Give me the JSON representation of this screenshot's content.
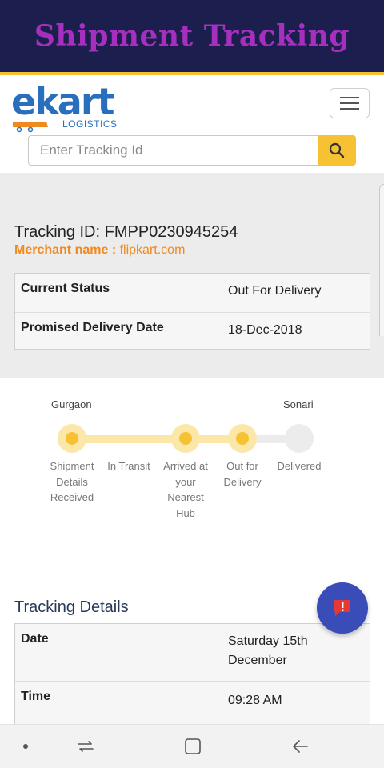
{
  "banner": {
    "title": "Shipment Tracking"
  },
  "brand": {
    "logo_text": "ekart",
    "logo_sub": "LOGISTICS"
  },
  "search": {
    "placeholder": "Enter Tracking Id",
    "value": ""
  },
  "shipment": {
    "tracking_label": "Tracking ID: FMPP0230945254",
    "merchant_label": "Merchant name : ",
    "merchant_value": "flipkart.com"
  },
  "status_table": [
    {
      "key": "Current Status",
      "value": "Out For Delivery"
    },
    {
      "key": "Promised Delivery Date",
      "value": "18-Dec-2018"
    }
  ],
  "progress": {
    "origin": "Gurgaon",
    "destination": "Sonari",
    "steps": [
      {
        "label": "Shipment Details Received",
        "done": true
      },
      {
        "label": "In Transit",
        "done": false
      },
      {
        "label": "Arrived at your Nearest Hub",
        "done": true
      },
      {
        "label": "Out for Delivery",
        "done": true
      },
      {
        "label": "Delivered",
        "done": false
      }
    ]
  },
  "tracking_details": {
    "title": "Tracking Details",
    "rows": [
      {
        "key": "Date",
        "value": "Saturday 15th December"
      },
      {
        "key": "Time",
        "value": "09:28 AM"
      }
    ]
  },
  "colors": {
    "banner_bg": "#1c1f4d",
    "banner_text": "#a62fc0",
    "accent": "#f6c133",
    "brand_blue": "#2a6fbd",
    "merchant_orange": "#f08a1e",
    "fab_bg": "#3a4cb8",
    "fab_icon": "#e53935"
  },
  "icons": {
    "search": "search-icon",
    "menu": "hamburger-menu-icon",
    "fab": "chat-alert-icon",
    "nav": [
      "dot-icon",
      "recent-apps-icon",
      "home-icon",
      "back-icon"
    ]
  }
}
